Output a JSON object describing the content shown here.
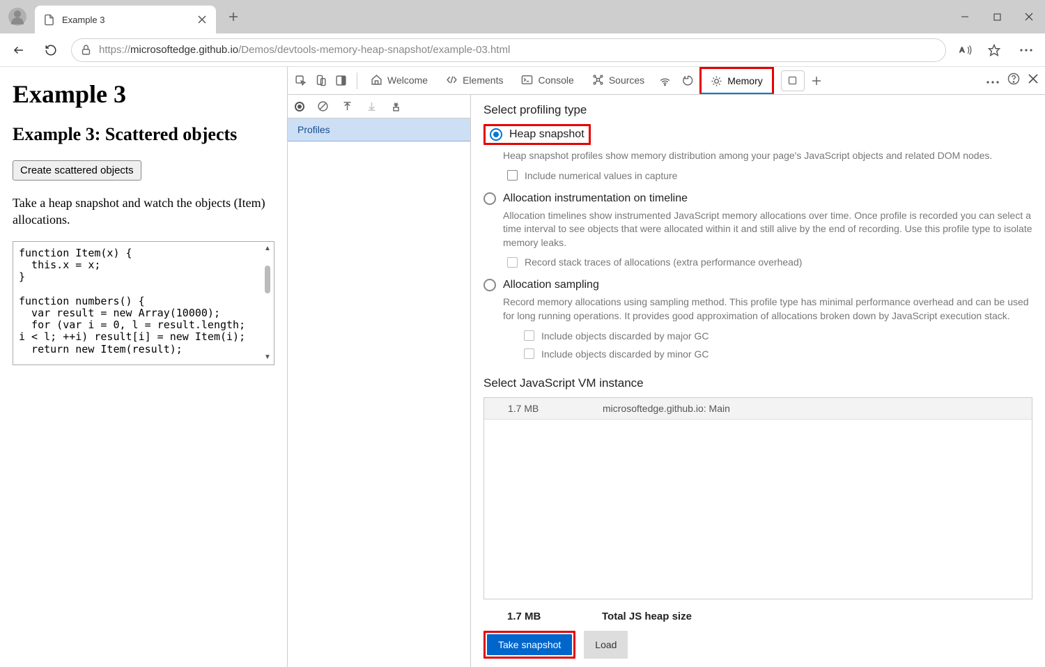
{
  "browser": {
    "tab_title": "Example 3",
    "url_host": "microsoftedge.github.io",
    "url_protocol": "https://",
    "url_path": "/Demos/devtools-memory-heap-snapshot/example-03.html"
  },
  "page": {
    "h1": "Example 3",
    "h2": "Example 3: Scattered objects",
    "button": "Create scattered objects",
    "desc": "Take a heap snapshot and watch the objects (Item) allocations.",
    "code": "function Item(x) {\n  this.x = x;\n}\n\nfunction numbers() {\n  var result = new Array(10000);\n  for (var i = 0, l = result.length;\ni < l; ++i) result[i] = new Item(i);\n  return new Item(result);"
  },
  "devtools": {
    "tabs": {
      "welcome": "Welcome",
      "elements": "Elements",
      "console": "Console",
      "sources": "Sources",
      "memory": "Memory"
    },
    "sidebar": {
      "profiles": "Profiles"
    },
    "memory": {
      "profiling_title": "Select profiling type",
      "opt1": {
        "label": "Heap snapshot",
        "desc": "Heap snapshot profiles show memory distribution among your page's JavaScript objects and related DOM nodes.",
        "sub": "Include numerical values in capture"
      },
      "opt2": {
        "label": "Allocation instrumentation on timeline",
        "desc": "Allocation timelines show instrumented JavaScript memory allocations over time. Once profile is recorded you can select a time interval to see objects that were allocated within it and still alive by the end of recording. Use this profile type to isolate memory leaks.",
        "sub": "Record stack traces of allocations (extra performance overhead)"
      },
      "opt3": {
        "label": "Allocation sampling",
        "desc": "Record memory allocations using sampling method. This profile type has minimal performance overhead and can be used for long running operations. It provides good approximation of allocations broken down by JavaScript execution stack.",
        "sub1": "Include objects discarded by major GC",
        "sub2": "Include objects discarded by minor GC"
      },
      "vm_title": "Select JavaScript VM instance",
      "vm_row": {
        "size": "1.7 MB",
        "name": "microsoftedge.github.io: Main"
      },
      "total": {
        "size": "1.7 MB",
        "label": "Total JS heap size"
      },
      "take_snapshot": "Take snapshot",
      "load": "Load"
    }
  }
}
